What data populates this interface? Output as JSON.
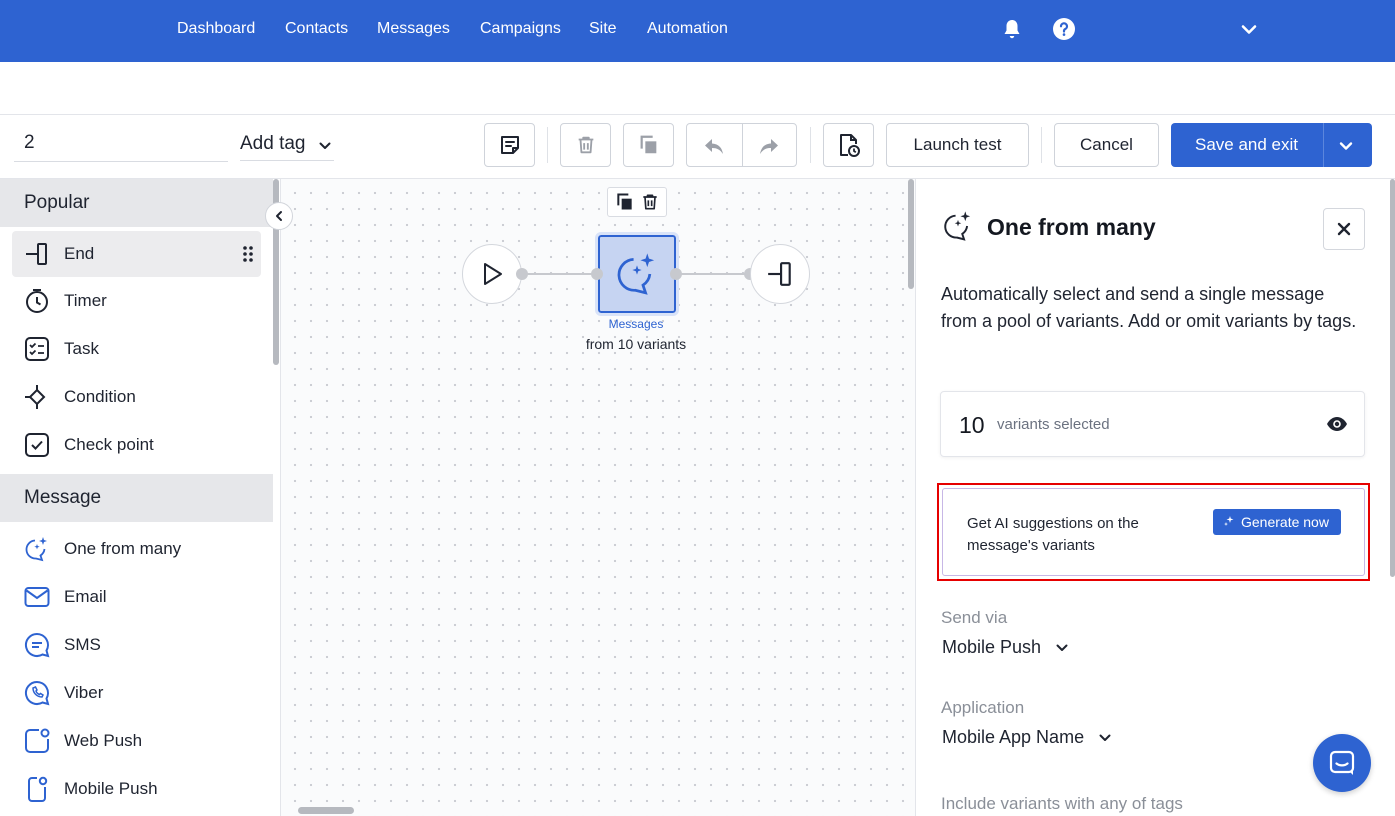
{
  "nav": {
    "items": [
      "Dashboard",
      "Contacts",
      "Messages",
      "Campaigns",
      "Site",
      "Automation"
    ],
    "icons": [
      "bell-icon",
      "help-icon",
      "chevron-down-icon"
    ]
  },
  "toolbar": {
    "name_value": "2",
    "tag_label": "Add tag",
    "launch_label": "Launch test",
    "cancel_label": "Cancel",
    "save_label": "Save and exit"
  },
  "left_panel": {
    "categories": [
      {
        "label": "Popular",
        "items": [
          {
            "label": "End",
            "icon": "end-icon"
          },
          {
            "label": "Timer",
            "icon": "timer-icon"
          },
          {
            "label": "Task",
            "icon": "task-icon"
          },
          {
            "label": "Condition",
            "icon": "condition-icon"
          },
          {
            "label": "Check point",
            "icon": "check-point-icon"
          }
        ]
      },
      {
        "label": "Message",
        "items": [
          {
            "label": "One from many",
            "icon": "ai-chat-icon"
          },
          {
            "label": "Email",
            "icon": "email-icon"
          },
          {
            "label": "SMS",
            "icon": "sms-icon"
          },
          {
            "label": "Viber",
            "icon": "viber-icon"
          },
          {
            "label": "Web Push",
            "icon": "web-push-icon"
          },
          {
            "label": "Mobile Push",
            "icon": "mobile-push-icon"
          }
        ]
      }
    ]
  },
  "canvas": {
    "node_caption": "Messages",
    "node_subcaption": "from 10 variants"
  },
  "right_panel": {
    "title": "One from many",
    "description": "Automatically select and send a single message from a pool of variants. Add or omit variants by tags.",
    "variants_count": "10",
    "variants_label": "variants selected",
    "ai_text": "Get AI suggestions on the message's variants",
    "ai_button": "Generate now",
    "send_via_label": "Send via",
    "send_via_value": "Mobile Push",
    "application_label": "Application",
    "application_value": "Mobile App Name",
    "include_label": "Include variants with any of tags"
  },
  "colors": {
    "primary": "#2e63d1",
    "highlight": "#e60000",
    "node_fill": "#c6d4f2"
  }
}
